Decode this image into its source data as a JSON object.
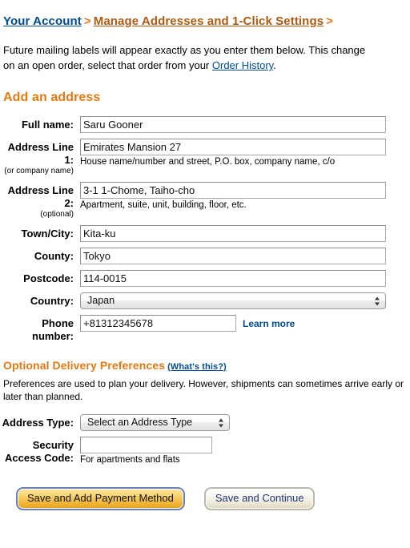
{
  "breadcrumb": {
    "home_label": "Your Account",
    "separator": ">",
    "current_label": "Manage Addresses and 1-Click Settings",
    "trailing_separator": ">"
  },
  "intro": {
    "line1": "Future mailing labels will appear exactly as you enter them below. This change",
    "line2_before": "on an open order, select that order from your ",
    "line2_link": "Order History",
    "line2_after": "."
  },
  "add_address": {
    "heading": "Add an address",
    "fields": {
      "full_name": {
        "label": "Full name:",
        "value": "Saru Gooner"
      },
      "address_line_1": {
        "label": "Address Line 1:",
        "sub_label": "(or company name)",
        "value": "Emirates Mansion 27",
        "hint": "House name/number and street, P.O. box, company name, c/o"
      },
      "address_line_2": {
        "label": "Address Line 2:",
        "sub_label": "(optional)",
        "value": "3-1 1-Chome, Taiho-cho",
        "hint": "Apartment, suite, unit, building, floor, etc."
      },
      "town_city": {
        "label": "Town/City:",
        "value": "Kita-ku"
      },
      "county": {
        "label": "County:",
        "value": "Tokyo"
      },
      "postcode": {
        "label": "Postcode:",
        "value": "114-0015"
      },
      "country": {
        "label": "Country:",
        "selected": "Japan"
      },
      "phone_number": {
        "label": "Phone number:",
        "value": "+81312345678",
        "learn_more_label": "Learn more"
      }
    }
  },
  "delivery_preferences": {
    "heading": "Optional Delivery Preferences",
    "whats_this_label": "(What's this?)",
    "note": "Preferences are used to plan your delivery. However, shipments can sometimes arrive early or later than planned.",
    "address_type": {
      "label": "Address Type:",
      "selected": "Select an Address Type"
    },
    "security_access_code": {
      "label": "Security Access Code:",
      "value": "",
      "hint": "For apartments and flats"
    }
  },
  "actions": {
    "primary_label": "Save and Add Payment Method",
    "secondary_label": "Save and Continue"
  },
  "colors": {
    "accent_orange": "#e47911",
    "link_blue": "#004b91",
    "crumb_brown": "#b05a11",
    "gold_button": "#e8a317"
  },
  "icons": {
    "select_arrows": "up-down-arrows-icon"
  }
}
